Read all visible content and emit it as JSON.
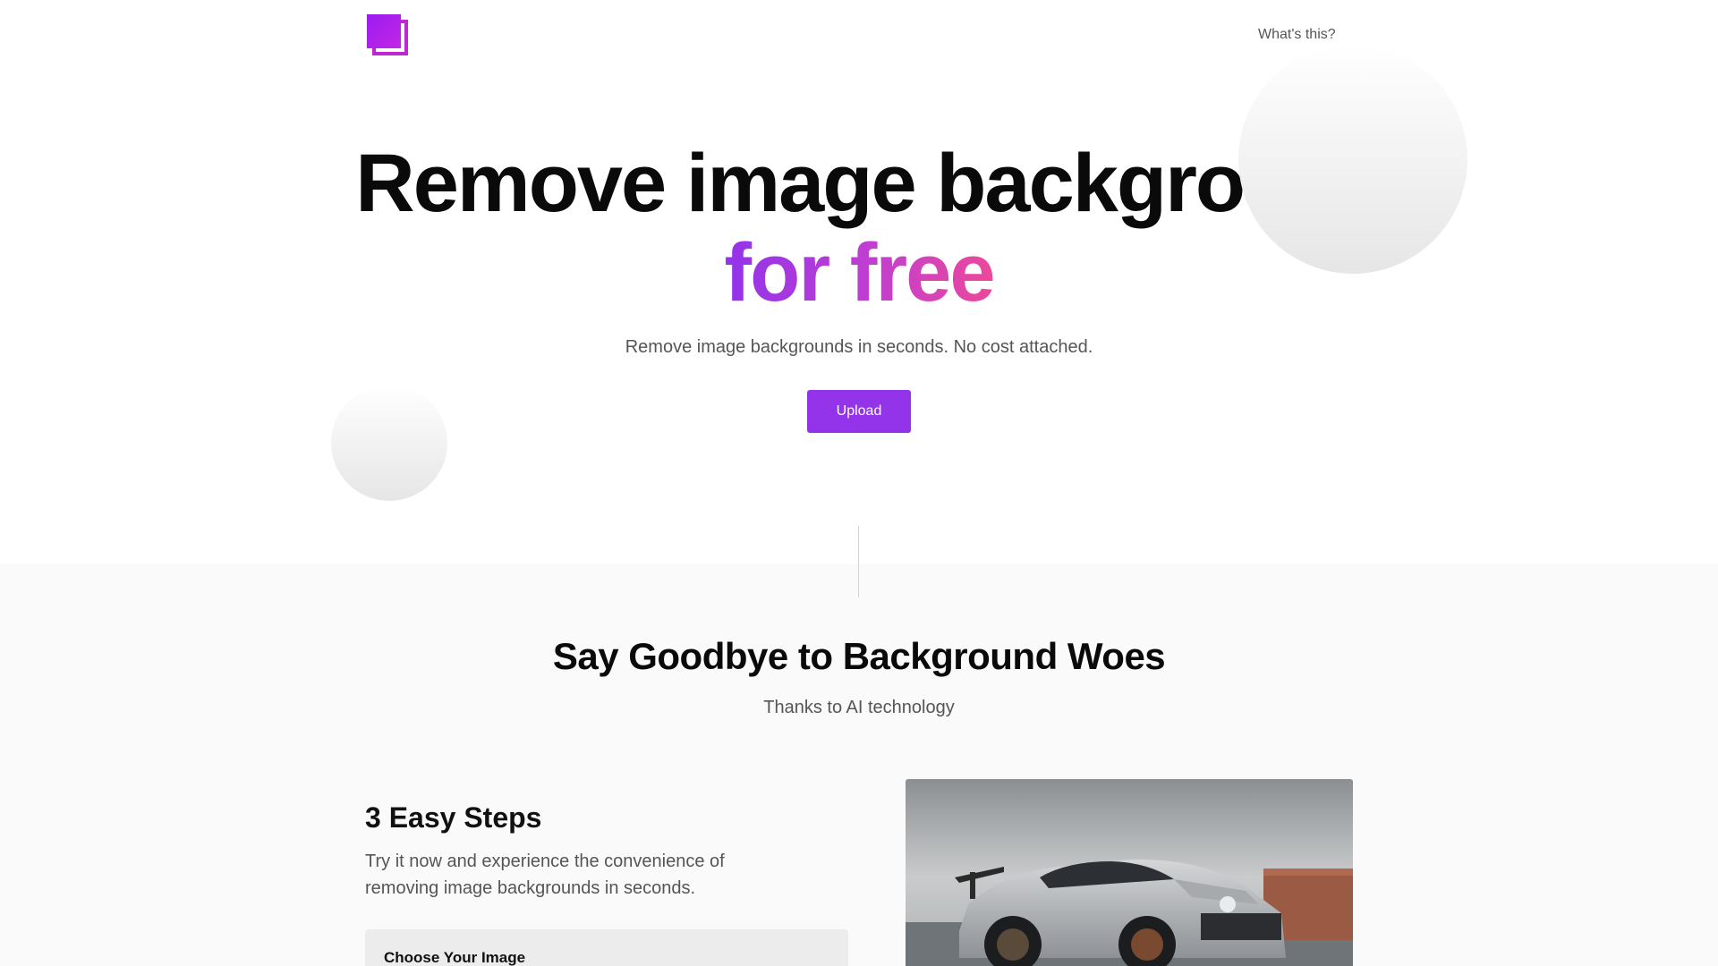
{
  "header": {
    "nav_link": "What's this?"
  },
  "hero": {
    "title_line1": "Remove image background",
    "title_line2": "for free",
    "subtitle": "Remove image backgrounds in seconds. No cost attached.",
    "upload_label": "Upload"
  },
  "section": {
    "title": "Say Goodbye to Background Woes",
    "subtitle": "Thanks to AI technology"
  },
  "steps": {
    "title": "3 Easy Steps",
    "description": "Try it now and experience the convenience of removing image backgrounds in seconds.",
    "cards": [
      {
        "label": "Choose Your Image"
      }
    ]
  },
  "colors": {
    "accent": "#9333ea",
    "gradient_start": "#9333ea",
    "gradient_end": "#ec4899"
  },
  "icons": {
    "logo": "layered-squares-logo-icon"
  }
}
